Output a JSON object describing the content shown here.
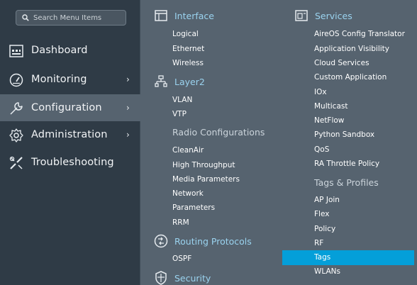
{
  "search": {
    "placeholder": "Search Menu Items"
  },
  "sidebar": {
    "items": [
      {
        "label": "Dashboard",
        "icon": "dashboard-icon",
        "has_submenu": false
      },
      {
        "label": "Monitoring",
        "icon": "gauge-icon",
        "has_submenu": true
      },
      {
        "label": "Configuration",
        "icon": "wrench-icon",
        "has_submenu": true,
        "active": true
      },
      {
        "label": "Administration",
        "icon": "gear-icon",
        "has_submenu": true
      },
      {
        "label": "Troubleshooting",
        "icon": "tools-icon",
        "has_submenu": false
      }
    ],
    "chevron": "›"
  },
  "menu": {
    "col1": {
      "sections": [
        {
          "title": "Interface",
          "icon": "window-icon",
          "items": [
            "Logical",
            "Ethernet",
            "Wireless"
          ]
        },
        {
          "title": "Layer2",
          "icon": "network-tree-icon",
          "items": [
            "VLAN",
            "VTP"
          ]
        },
        {
          "title": "Radio Configurations",
          "icon": "",
          "items": [
            "CleanAir",
            "High Throughput",
            "Media Parameters",
            "Network",
            "Parameters",
            "RRM"
          ]
        },
        {
          "title": "Routing Protocols",
          "icon": "routing-icon",
          "items": [
            "OSPF"
          ]
        },
        {
          "title": "Security",
          "icon": "shield-icon",
          "items": []
        }
      ]
    },
    "col2": {
      "sections": [
        {
          "title": "Services",
          "icon": "services-icon",
          "items": [
            "AireOS Config Translator",
            "Application Visibility",
            "Cloud Services",
            "Custom Application",
            "IOx",
            "Multicast",
            "NetFlow",
            "Python Sandbox",
            "QoS",
            "RA Throttle Policy"
          ]
        },
        {
          "title": "Tags & Profiles",
          "icon": "",
          "items": [
            "AP Join",
            "Flex",
            "Policy",
            "RF",
            "Tags",
            "WLANs"
          ]
        }
      ],
      "highlighted": "Tags"
    }
  },
  "colors": {
    "sidebar_bg": "#2f3b46",
    "panel_bg": "#56636f",
    "accent": "#049fd9",
    "heading": "#9ad3ef"
  }
}
